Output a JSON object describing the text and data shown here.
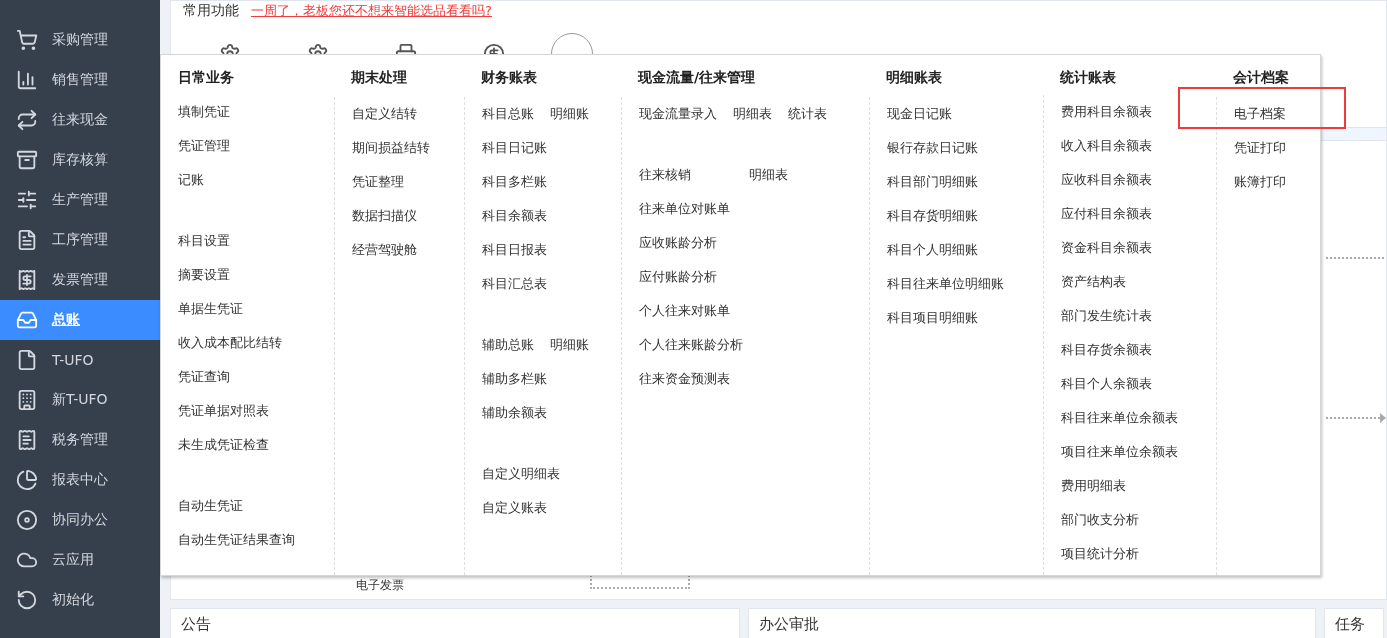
{
  "sidebar": {
    "items": [
      {
        "label": "采购管理",
        "selected": false
      },
      {
        "label": "销售管理",
        "selected": false
      },
      {
        "label": "往来现金",
        "selected": false
      },
      {
        "label": "库存核算",
        "selected": false
      },
      {
        "label": "生产管理",
        "selected": false
      },
      {
        "label": "工序管理",
        "selected": false
      },
      {
        "label": "发票管理",
        "selected": false
      },
      {
        "label": "总账",
        "selected": true
      },
      {
        "label": "T-UFO",
        "selected": false
      },
      {
        "label": "新T-UFO",
        "selected": false
      },
      {
        "label": "税务管理",
        "selected": false
      },
      {
        "label": "报表中心",
        "selected": false
      },
      {
        "label": "协同办公",
        "selected": false
      },
      {
        "label": "云应用",
        "selected": false
      },
      {
        "label": "初始化",
        "selected": false
      }
    ]
  },
  "common_functions": {
    "title": "常用功能",
    "promo_link": "一周了，老板您还不想来智能选品看看吗?"
  },
  "hidden_label": "电子发票",
  "mega_menu": {
    "columns": [
      {
        "title": "日常业务",
        "groups": [
          [
            [
              {
                "label": "填制凭证"
              }
            ],
            [
              {
                "label": "凭证管理"
              }
            ],
            [
              {
                "label": "记账"
              }
            ]
          ],
          [
            [
              {
                "label": "科目设置"
              }
            ],
            [
              {
                "label": "摘要设置"
              }
            ],
            [
              {
                "label": "单据生凭证"
              }
            ],
            [
              {
                "label": "收入成本配比结转"
              }
            ],
            [
              {
                "label": "凭证查询"
              }
            ],
            [
              {
                "label": "凭证单据对照表"
              }
            ],
            [
              {
                "label": "未生成凭证检查"
              }
            ]
          ],
          [
            [
              {
                "label": "自动生凭证"
              }
            ],
            [
              {
                "label": "自动生凭证结果查询"
              }
            ]
          ]
        ]
      },
      {
        "title": "期末处理",
        "groups": [
          [
            [
              {
                "label": "自定义结转"
              }
            ],
            [
              {
                "label": "期间损益结转"
              }
            ],
            [
              {
                "label": "凭证整理"
              }
            ],
            [
              {
                "label": "数据扫描仪"
              }
            ],
            [
              {
                "label": "经营驾驶舱"
              }
            ]
          ]
        ]
      },
      {
        "title": "财务账表",
        "groups": [
          [
            [
              {
                "label": "科目总账"
              },
              {
                "label": "明细账"
              }
            ],
            [
              {
                "label": "科目日记账"
              }
            ],
            [
              {
                "label": "科目多栏账"
              }
            ],
            [
              {
                "label": "科目余额表"
              }
            ],
            [
              {
                "label": "科目日报表"
              }
            ],
            [
              {
                "label": "科目汇总表"
              }
            ]
          ],
          [
            [
              {
                "label": "辅助总账"
              },
              {
                "label": "明细账"
              }
            ],
            [
              {
                "label": "辅助多栏账"
              }
            ],
            [
              {
                "label": "辅助余额表"
              }
            ]
          ],
          [
            [
              {
                "label": "自定义明细表"
              }
            ],
            [
              {
                "label": "自定义账表"
              }
            ]
          ]
        ]
      },
      {
        "title": "现金流量/往来管理",
        "groups": [
          [
            [
              {
                "label": "现金流量录入"
              },
              {
                "label": "明细表"
              },
              {
                "label": "统计表"
              }
            ]
          ],
          [
            [
              {
                "label": "往来核销"
              },
              {
                "label": "明细表"
              }
            ],
            [
              {
                "label": "往来单位对账单"
              }
            ],
            [
              {
                "label": "应收账龄分析"
              }
            ],
            [
              {
                "label": "应付账龄分析"
              }
            ],
            [
              {
                "label": "个人往来对账单"
              }
            ],
            [
              {
                "label": "个人往来账龄分析"
              }
            ],
            [
              {
                "label": "往来资金预测表"
              }
            ]
          ]
        ]
      },
      {
        "title": "明细账表",
        "groups": [
          [
            [
              {
                "label": "现金日记账"
              }
            ],
            [
              {
                "label": "银行存款日记账"
              }
            ],
            [
              {
                "label": "科目部门明细账"
              }
            ],
            [
              {
                "label": "科目存货明细账"
              }
            ],
            [
              {
                "label": "科目个人明细账"
              }
            ],
            [
              {
                "label": "科目往来单位明细账"
              }
            ],
            [
              {
                "label": "科目项目明细账"
              }
            ]
          ]
        ]
      },
      {
        "title": "统计账表",
        "groups": [
          [
            [
              {
                "label": "费用科目余额表"
              }
            ],
            [
              {
                "label": "收入科目余额表"
              }
            ],
            [
              {
                "label": "应收科目余额表"
              }
            ],
            [
              {
                "label": "应付科目余额表"
              }
            ],
            [
              {
                "label": "资金科目余额表"
              }
            ],
            [
              {
                "label": "资产结构表"
              }
            ],
            [
              {
                "label": "部门发生统计表"
              }
            ],
            [
              {
                "label": "科目存货余额表"
              }
            ],
            [
              {
                "label": "科目个人余额表"
              }
            ],
            [
              {
                "label": "科目往来单位余额表"
              }
            ],
            [
              {
                "label": "项目往来单位余额表"
              }
            ],
            [
              {
                "label": "费用明细表"
              }
            ],
            [
              {
                "label": "部门收支分析"
              }
            ],
            [
              {
                "label": "项目统计分析"
              }
            ]
          ]
        ]
      },
      {
        "title": "会计档案",
        "groups": [
          [
            [
              {
                "label": "电子档案",
                "highlighted": true
              }
            ],
            [
              {
                "label": "凭证打印"
              }
            ],
            [
              {
                "label": "账簿打印"
              }
            ]
          ]
        ]
      }
    ]
  },
  "panels": [
    {
      "title": "公告"
    },
    {
      "title": "办公审批"
    },
    {
      "title": "任务"
    }
  ]
}
